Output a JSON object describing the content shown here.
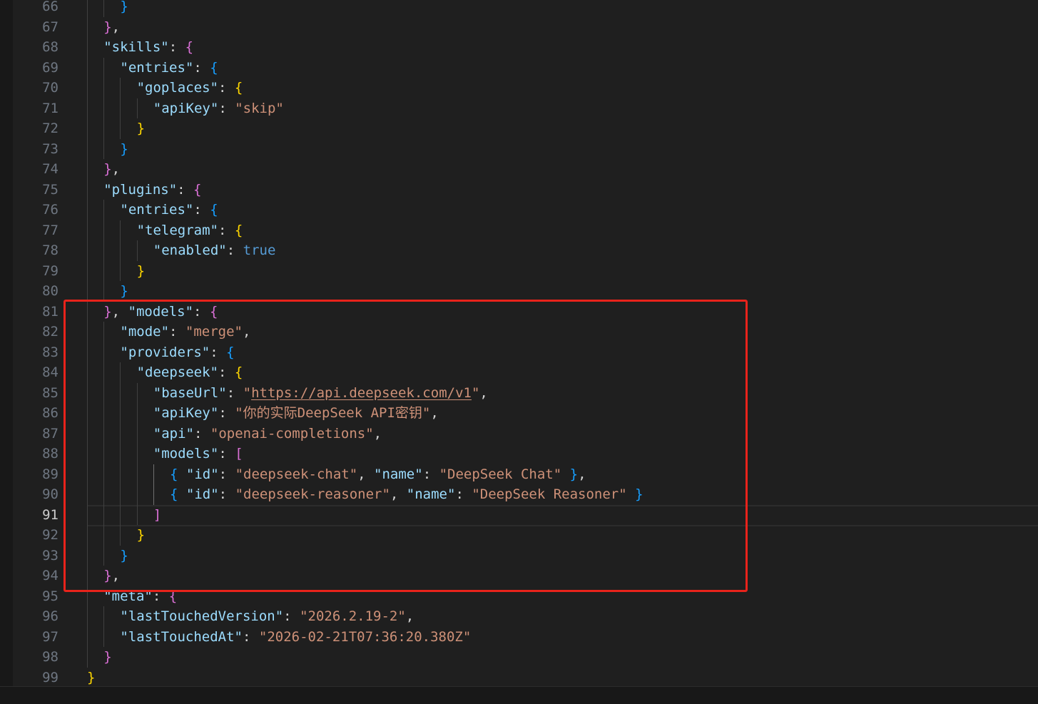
{
  "editor": {
    "active_line": 91,
    "colors": {
      "background": "#1f1f1f",
      "json_key": "#9cdcfe",
      "json_string": "#ce9178",
      "bracket_level_1": "#ffd700",
      "bracket_level_2": "#da70d6",
      "bracket_level_3": "#179fff",
      "boolean": "#569cd6",
      "annotation_box": "#e8231b"
    },
    "lines": [
      {
        "n": "66",
        "indent": 5,
        "tokens": [
          {
            "t": "}",
            "c": "b3"
          }
        ]
      },
      {
        "n": "67",
        "indent": 3,
        "tokens": [
          {
            "t": "}",
            "c": "b2"
          },
          {
            "t": ",",
            "c": "p"
          }
        ]
      },
      {
        "n": "68",
        "indent": 3,
        "tokens": [
          {
            "t": "\"skills\"",
            "c": "k"
          },
          {
            "t": ": ",
            "c": "p"
          },
          {
            "t": "{",
            "c": "b2"
          }
        ]
      },
      {
        "n": "69",
        "indent": 5,
        "tokens": [
          {
            "t": "\"entries\"",
            "c": "k"
          },
          {
            "t": ": ",
            "c": "p"
          },
          {
            "t": "{",
            "c": "b3"
          }
        ]
      },
      {
        "n": "70",
        "indent": 7,
        "tokens": [
          {
            "t": "\"goplaces\"",
            "c": "k"
          },
          {
            "t": ": ",
            "c": "p"
          },
          {
            "t": "{",
            "c": "b1"
          }
        ]
      },
      {
        "n": "71",
        "indent": 9,
        "tokens": [
          {
            "t": "\"apiKey\"",
            "c": "k"
          },
          {
            "t": ": ",
            "c": "p"
          },
          {
            "t": "\"skip\"",
            "c": "s"
          }
        ]
      },
      {
        "n": "72",
        "indent": 7,
        "tokens": [
          {
            "t": "}",
            "c": "b1"
          }
        ]
      },
      {
        "n": "73",
        "indent": 5,
        "tokens": [
          {
            "t": "}",
            "c": "b3"
          }
        ]
      },
      {
        "n": "74",
        "indent": 3,
        "tokens": [
          {
            "t": "}",
            "c": "b2"
          },
          {
            "t": ",",
            "c": "p"
          }
        ]
      },
      {
        "n": "75",
        "indent": 3,
        "tokens": [
          {
            "t": "\"plugins\"",
            "c": "k"
          },
          {
            "t": ": ",
            "c": "p"
          },
          {
            "t": "{",
            "c": "b2"
          }
        ]
      },
      {
        "n": "76",
        "indent": 5,
        "tokens": [
          {
            "t": "\"entries\"",
            "c": "k"
          },
          {
            "t": ": ",
            "c": "p"
          },
          {
            "t": "{",
            "c": "b3"
          }
        ]
      },
      {
        "n": "77",
        "indent": 7,
        "tokens": [
          {
            "t": "\"telegram\"",
            "c": "k"
          },
          {
            "t": ": ",
            "c": "p"
          },
          {
            "t": "{",
            "c": "b1"
          }
        ]
      },
      {
        "n": "78",
        "indent": 9,
        "tokens": [
          {
            "t": "\"enabled\"",
            "c": "k"
          },
          {
            "t": ": ",
            "c": "p"
          },
          {
            "t": "true",
            "c": "kw"
          }
        ]
      },
      {
        "n": "79",
        "indent": 7,
        "tokens": [
          {
            "t": "}",
            "c": "b1"
          }
        ]
      },
      {
        "n": "80",
        "indent": 5,
        "tokens": [
          {
            "t": "}",
            "c": "b3"
          }
        ]
      },
      {
        "n": "81",
        "indent": 3,
        "tokens": [
          {
            "t": "}",
            "c": "b2"
          },
          {
            "t": ", ",
            "c": "p"
          },
          {
            "t": "\"models\"",
            "c": "k"
          },
          {
            "t": ": ",
            "c": "p"
          },
          {
            "t": "{",
            "c": "b2"
          }
        ]
      },
      {
        "n": "82",
        "indent": 5,
        "tokens": [
          {
            "t": "\"mode\"",
            "c": "k"
          },
          {
            "t": ": ",
            "c": "p"
          },
          {
            "t": "\"merge\"",
            "c": "s"
          },
          {
            "t": ",",
            "c": "p"
          }
        ]
      },
      {
        "n": "83",
        "indent": 5,
        "tokens": [
          {
            "t": "\"providers\"",
            "c": "k"
          },
          {
            "t": ": ",
            "c": "p"
          },
          {
            "t": "{",
            "c": "b3"
          }
        ]
      },
      {
        "n": "84",
        "indent": 7,
        "tokens": [
          {
            "t": "\"deepseek\"",
            "c": "k"
          },
          {
            "t": ": ",
            "c": "p"
          },
          {
            "t": "{",
            "c": "b1"
          }
        ]
      },
      {
        "n": "85",
        "indent": 9,
        "tokens": [
          {
            "t": "\"baseUrl\"",
            "c": "k"
          },
          {
            "t": ": ",
            "c": "p"
          },
          {
            "t": "\"",
            "c": "s"
          },
          {
            "t": "https://api.deepseek.com/v1",
            "c": "s url"
          },
          {
            "t": "\"",
            "c": "s"
          },
          {
            "t": ",",
            "c": "p"
          }
        ]
      },
      {
        "n": "86",
        "indent": 9,
        "tokens": [
          {
            "t": "\"apiKey\"",
            "c": "k"
          },
          {
            "t": ": ",
            "c": "p"
          },
          {
            "t": "\"你的实际DeepSeek API密钥\"",
            "c": "s"
          },
          {
            "t": ",",
            "c": "p"
          }
        ]
      },
      {
        "n": "87",
        "indent": 9,
        "tokens": [
          {
            "t": "\"api\"",
            "c": "k"
          },
          {
            "t": ": ",
            "c": "p"
          },
          {
            "t": "\"openai-completions\"",
            "c": "s"
          },
          {
            "t": ",",
            "c": "p"
          }
        ]
      },
      {
        "n": "88",
        "indent": 9,
        "tokens": [
          {
            "t": "\"models\"",
            "c": "k"
          },
          {
            "t": ": ",
            "c": "p"
          },
          {
            "t": "[",
            "c": "b2"
          }
        ]
      },
      {
        "n": "89",
        "indent": 11,
        "tokens": [
          {
            "t": "{",
            "c": "b3"
          },
          {
            "t": " ",
            "c": "p"
          },
          {
            "t": "\"id\"",
            "c": "k"
          },
          {
            "t": ": ",
            "c": "p"
          },
          {
            "t": "\"deepseek-chat\"",
            "c": "s"
          },
          {
            "t": ", ",
            "c": "p"
          },
          {
            "t": "\"name\"",
            "c": "k"
          },
          {
            "t": ": ",
            "c": "p"
          },
          {
            "t": "\"DeepSeek Chat\"",
            "c": "s"
          },
          {
            "t": " ",
            "c": "p"
          },
          {
            "t": "}",
            "c": "b3"
          },
          {
            "t": ",",
            "c": "p"
          }
        ]
      },
      {
        "n": "90",
        "indent": 11,
        "tokens": [
          {
            "t": "{",
            "c": "b3"
          },
          {
            "t": " ",
            "c": "p"
          },
          {
            "t": "\"id\"",
            "c": "k"
          },
          {
            "t": ": ",
            "c": "p"
          },
          {
            "t": "\"deepseek-reasoner\"",
            "c": "s"
          },
          {
            "t": ", ",
            "c": "p"
          },
          {
            "t": "\"name\"",
            "c": "k"
          },
          {
            "t": ": ",
            "c": "p"
          },
          {
            "t": "\"DeepSeek Reasoner\"",
            "c": "s"
          },
          {
            "t": " ",
            "c": "p"
          },
          {
            "t": "}",
            "c": "b3"
          }
        ]
      },
      {
        "n": "91",
        "indent": 9,
        "tokens": [
          {
            "t": "]",
            "c": "b2"
          }
        ]
      },
      {
        "n": "92",
        "indent": 7,
        "tokens": [
          {
            "t": "}",
            "c": "b1"
          }
        ]
      },
      {
        "n": "93",
        "indent": 5,
        "tokens": [
          {
            "t": "}",
            "c": "b3"
          }
        ]
      },
      {
        "n": "94",
        "indent": 3,
        "tokens": [
          {
            "t": "}",
            "c": "b2"
          },
          {
            "t": ",",
            "c": "p"
          }
        ]
      },
      {
        "n": "95",
        "indent": 3,
        "tokens": [
          {
            "t": "\"meta\"",
            "c": "k"
          },
          {
            "t": ": ",
            "c": "p"
          },
          {
            "t": "{",
            "c": "b2"
          }
        ]
      },
      {
        "n": "96",
        "indent": 5,
        "tokens": [
          {
            "t": "\"lastTouchedVersion\"",
            "c": "k"
          },
          {
            "t": ": ",
            "c": "p"
          },
          {
            "t": "\"2026.2.19-2\"",
            "c": "s"
          },
          {
            "t": ",",
            "c": "p"
          }
        ]
      },
      {
        "n": "97",
        "indent": 5,
        "tokens": [
          {
            "t": "\"lastTouchedAt\"",
            "c": "k"
          },
          {
            "t": ": ",
            "c": "p"
          },
          {
            "t": "\"2026-02-21T07:36:20.380Z\"",
            "c": "s"
          }
        ]
      },
      {
        "n": "98",
        "indent": 3,
        "tokens": [
          {
            "t": "}",
            "c": "b2"
          }
        ]
      },
      {
        "n": "99",
        "indent": 1,
        "tokens": [
          {
            "t": "}",
            "c": "b1"
          }
        ]
      }
    ]
  }
}
